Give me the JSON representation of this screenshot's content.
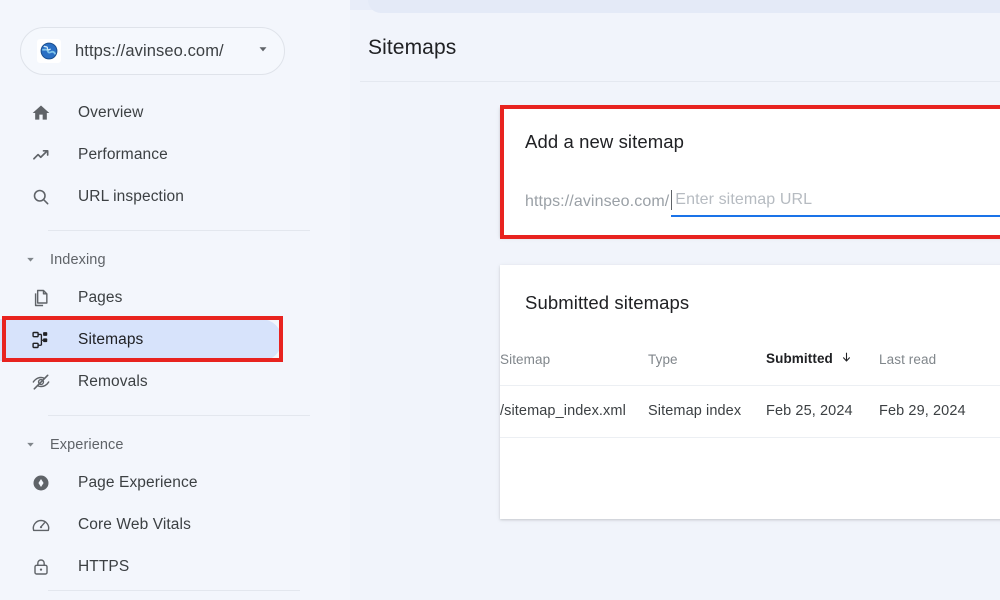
{
  "property_selector": {
    "favicon": "globe-favicon",
    "url": "https://avinseo.com/",
    "caret": "chevron-down-icon"
  },
  "sidebar": {
    "primary_items": [
      {
        "label": "Overview",
        "icon": "home-icon",
        "active": false
      },
      {
        "label": "Performance",
        "icon": "trending-up-icon",
        "active": false
      },
      {
        "label": "URL inspection",
        "icon": "search-icon",
        "active": false
      }
    ],
    "sections": [
      {
        "title": "Indexing",
        "chevron": "chevron-down-icon",
        "items": [
          {
            "label": "Pages",
            "icon": "pages-copy-icon",
            "active": false
          },
          {
            "label": "Sitemaps",
            "icon": "account-tree-icon",
            "active": true
          },
          {
            "label": "Removals",
            "icon": "eye-off-icon",
            "active": false
          }
        ]
      },
      {
        "title": "Experience",
        "chevron": "chevron-down-icon",
        "items": [
          {
            "label": "Page Experience",
            "icon": "page-experience-icon",
            "active": false
          },
          {
            "label": "Core Web Vitals",
            "icon": "speedometer-icon",
            "active": false
          },
          {
            "label": "HTTPS",
            "icon": "lock-icon",
            "active": false
          }
        ]
      }
    ]
  },
  "main": {
    "page_title": "Sitemaps",
    "add_sitemap": {
      "title": "Add a new sitemap",
      "url_prefix": "https://avinseo.com/",
      "input_value": "",
      "input_placeholder": "Enter sitemap URL",
      "focused": true
    },
    "submitted_sitemaps": {
      "title": "Submitted sitemaps",
      "columns": [
        {
          "label": "Sitemap",
          "sorted": false
        },
        {
          "label": "Type",
          "sorted": false
        },
        {
          "label": "Submitted",
          "sorted": true,
          "sort_icon": "arrow-down-icon"
        },
        {
          "label": "Last read",
          "sorted": false
        }
      ],
      "rows": [
        {
          "sitemap": "/sitemap_index.xml",
          "type": "Sitemap index",
          "submitted": "Feb 25, 2024",
          "last_read": "Feb 29, 2024"
        }
      ]
    }
  },
  "annotations": {
    "highlight_color": "#e8231f",
    "boxes": [
      {
        "name": "add-sitemap-card-highlight"
      },
      {
        "name": "sitemaps-nav-highlight"
      }
    ]
  },
  "colors": {
    "accent": "#1a73e8",
    "active_nav_bg": "#d7e3fb",
    "page_bg": "#f1f4fb",
    "card_bg": "#ffffff",
    "annotation_red": "#e8231f"
  }
}
